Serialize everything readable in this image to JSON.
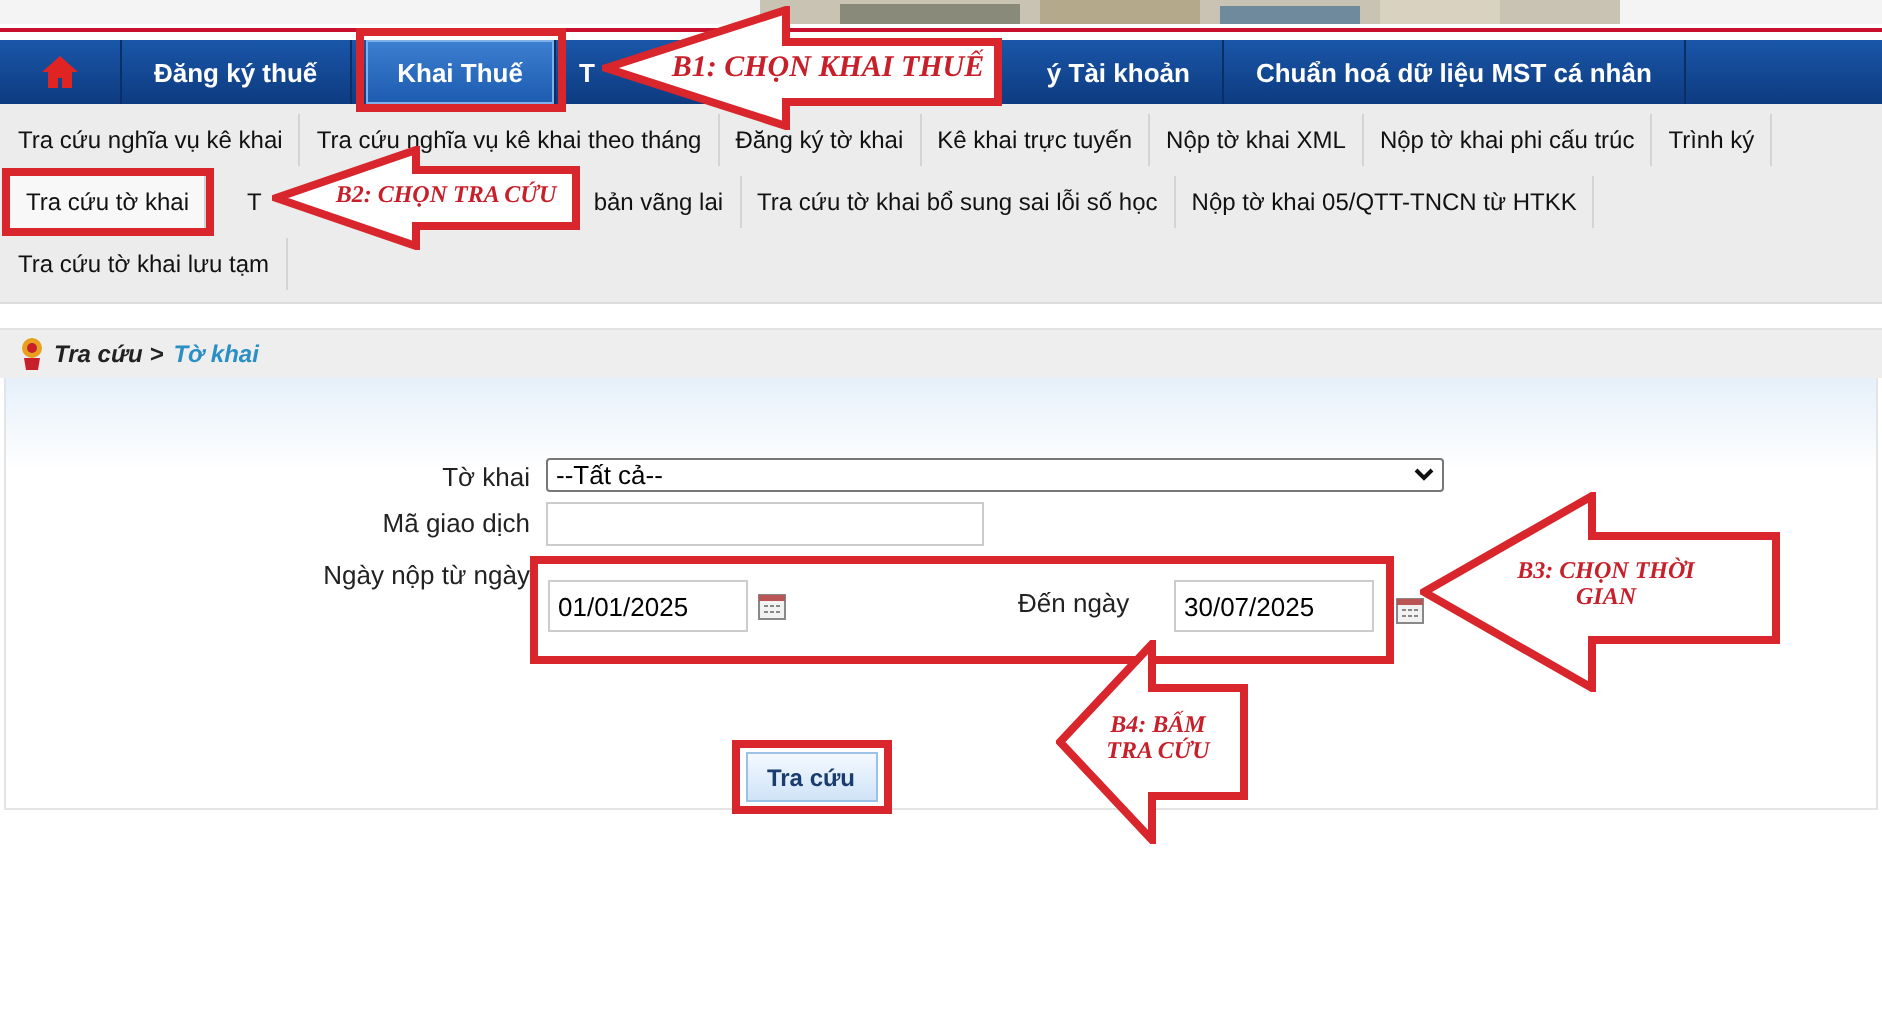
{
  "top_nav": [
    {
      "kind": "home",
      "selected": false
    },
    {
      "kind": "text",
      "label": "Đăng ký thuế",
      "selected": false
    },
    {
      "kind": "text",
      "label": "Khai Thuế",
      "selected": true
    },
    {
      "kind": "cut_end",
      "label": "T",
      "selected": false
    },
    {
      "kind": "text",
      "label": "ý Tài khoản",
      "selected": false
    },
    {
      "kind": "text",
      "label": "Chuẩn hoá dữ liệu MST cá nhân",
      "selected": false
    }
  ],
  "sub_nav": [
    [
      {
        "kind": "text",
        "label": "Tra cứu nghĩa vụ kê khai",
        "selected": false
      },
      {
        "kind": "text",
        "label": "Tra cứu nghĩa vụ kê khai theo tháng",
        "selected": false
      },
      {
        "kind": "text",
        "label": "Đăng ký tờ khai",
        "selected": false
      },
      {
        "kind": "text",
        "label": "Kê khai trực tuyến",
        "selected": false
      },
      {
        "kind": "text",
        "label": "Nộp tờ khai XML",
        "selected": false
      },
      {
        "kind": "text",
        "label": "Nộp tờ khai phi cấu trúc",
        "selected": false
      },
      {
        "kind": "text",
        "label": "Trình ký",
        "selected": false
      }
    ],
    [
      {
        "kind": "text",
        "label": "Tra cứu tờ khai",
        "selected": true
      },
      {
        "kind": "cut_end",
        "label": "T",
        "selected": false
      },
      {
        "kind": "text",
        "label": "bản vãng lai",
        "selected": false
      },
      {
        "kind": "text",
        "label": "Tra cứu tờ khai bổ sung sai lỗi số học",
        "selected": false
      },
      {
        "kind": "text",
        "label": "Nộp tờ khai 05/QTT-TNCN từ HTKK",
        "selected": false
      }
    ],
    [
      {
        "kind": "text",
        "label": "Tra cứu tờ khai lưu tạm",
        "selected": false
      }
    ]
  ],
  "breadcrumb": {
    "parent": "Tra cứu >",
    "current": "Tờ khai"
  },
  "form": {
    "declaration": {
      "label": "Tờ khai",
      "value": "--Tất cả--"
    },
    "transaction_code": {
      "label": "Mã giao dịch"
    },
    "from_date": {
      "label": "Ngày nộp từ ngày",
      "value": "01/01/2025"
    },
    "to_date": {
      "label": "Đến ngày",
      "value": "30/07/2025"
    },
    "submit": "Tra cứu"
  },
  "callouts": [
    {
      "text": "B1: CHỌN KHAI THUẾ"
    },
    {
      "text": "B2: CHỌN TRA CỨU"
    },
    {
      "text": "B3: CHỌN THỜI GIAN"
    },
    {
      "text": "B4: BẤM TRA CỨU"
    }
  ]
}
